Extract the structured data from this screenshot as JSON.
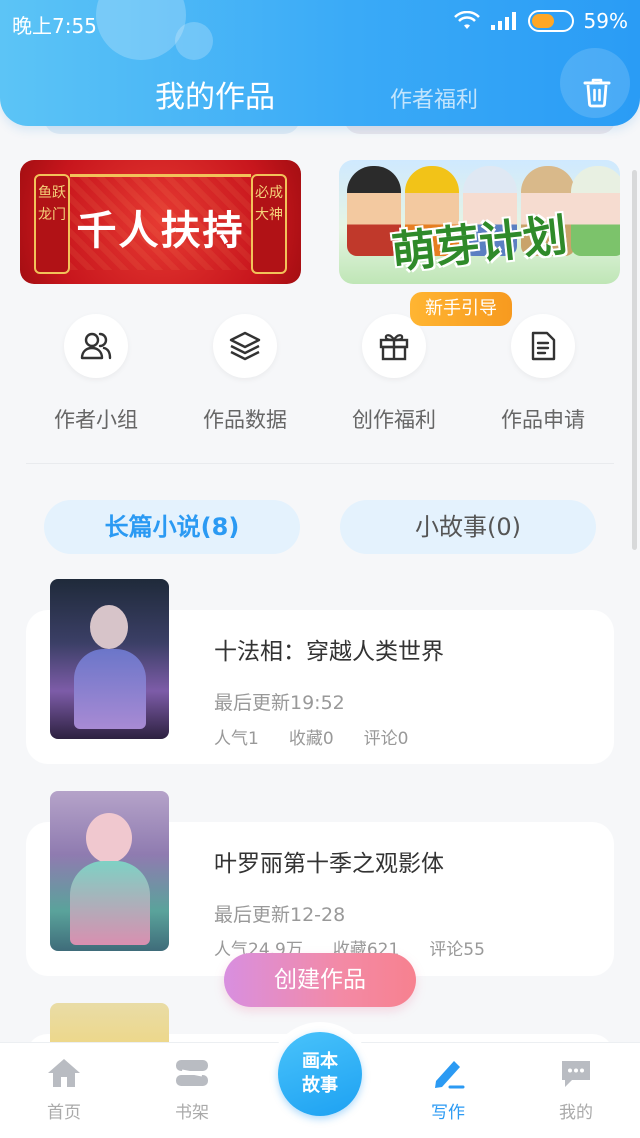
{
  "status_bar": {
    "time": "晚上7:55",
    "battery": "59%",
    "battery_level": 0.59
  },
  "header": {
    "active_tab": "我的作品",
    "other_tab": "作者福利",
    "trash_icon": "trash-icon"
  },
  "banners": {
    "left": {
      "text": "千人扶持",
      "scroll_left": "鱼跃龙门",
      "scroll_right": "必成大神"
    },
    "right": {
      "text": "萌芽计划"
    },
    "guide_badge": "新手引导"
  },
  "actions": [
    {
      "label": "作者小组",
      "icon": "people-icon"
    },
    {
      "label": "作品数据",
      "icon": "layers-icon"
    },
    {
      "label": "创作福利",
      "icon": "gift-icon"
    },
    {
      "label": "作品申请",
      "icon": "document-icon"
    }
  ],
  "category_tabs": {
    "novel": "长篇小说(8)",
    "story": "小故事(0)"
  },
  "works": [
    {
      "title": "十法相：穿越人类世界",
      "update": "最后更新19:52",
      "popularity": "人气1",
      "favorites": "收藏0",
      "comments": "评论0"
    },
    {
      "title": "叶罗丽第十季之观影体",
      "update": "最后更新12-28",
      "popularity": "人气24.9万",
      "favorites": "收藏621",
      "comments": "评论55"
    }
  ],
  "create_button": "创建作品",
  "bottom_nav": {
    "home": "首页",
    "shelf": "书架",
    "center": "画本故事",
    "write": "写作",
    "me": "我的"
  },
  "colors": {
    "accent": "#2b9af3",
    "header_gradient_start": "#5cc4f6",
    "create_button_start": "#d88fe0",
    "create_button_end": "#f7818f"
  }
}
